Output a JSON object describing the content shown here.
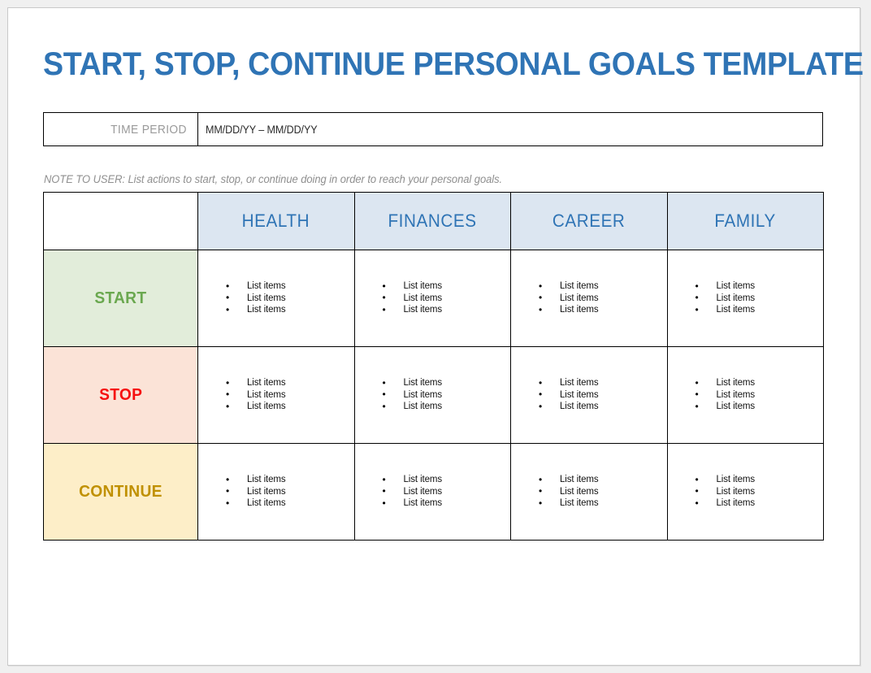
{
  "document": {
    "title": "START, STOP, CONTINUE PERSONAL GOALS TEMPLATE",
    "note": "NOTE TO USER: List actions to start, stop, or continue doing in order to reach your personal goals."
  },
  "time_period": {
    "label": "TIME PERIOD",
    "value": "MM/DD/YY – MM/DD/YY",
    "placeholder": "MM/DD/YY – MM/DD/YY"
  },
  "table": {
    "corner_label": "",
    "columns": [
      {
        "label": "HEALTH"
      },
      {
        "label": "FINANCES"
      },
      {
        "label": "CAREER"
      },
      {
        "label": "FAMILY"
      }
    ],
    "rows": [
      {
        "label": "START",
        "text_color": "#6aa84f",
        "background": "#e2edda",
        "cells": [
          {
            "items": [
              "List items",
              "List items",
              "List items"
            ]
          },
          {
            "items": [
              "List items",
              "List items",
              "List items"
            ]
          },
          {
            "items": [
              "List items",
              "List items",
              "List items"
            ]
          },
          {
            "items": [
              "List items",
              "List items",
              "List items"
            ]
          }
        ]
      },
      {
        "label": "STOP",
        "text_color": "#f60f0f",
        "background": "#fbe3d7",
        "cells": [
          {
            "items": [
              "List items",
              "List items",
              "List items"
            ]
          },
          {
            "items": [
              "List items",
              "List items",
              "List items"
            ]
          },
          {
            "items": [
              "List items",
              "List items",
              "List items"
            ]
          },
          {
            "items": [
              "List items",
              "List items",
              "List items"
            ]
          }
        ]
      },
      {
        "label": "CONTINUE",
        "text_color": "#c09000",
        "background": "#fdeec8",
        "cells": [
          {
            "items": [
              "List items",
              "List items",
              "List items"
            ]
          },
          {
            "items": [
              "List items",
              "List items",
              "List items"
            ]
          },
          {
            "items": [
              "List items",
              "List items",
              "List items"
            ]
          },
          {
            "items": [
              "List items",
              "List items",
              "List items"
            ]
          }
        ]
      }
    ]
  },
  "colors": {
    "title_blue": "#2f74b5",
    "header_fill": "#dce6f1",
    "note_gray": "#8f8f8f",
    "label_gray": "#9a9a9a"
  }
}
